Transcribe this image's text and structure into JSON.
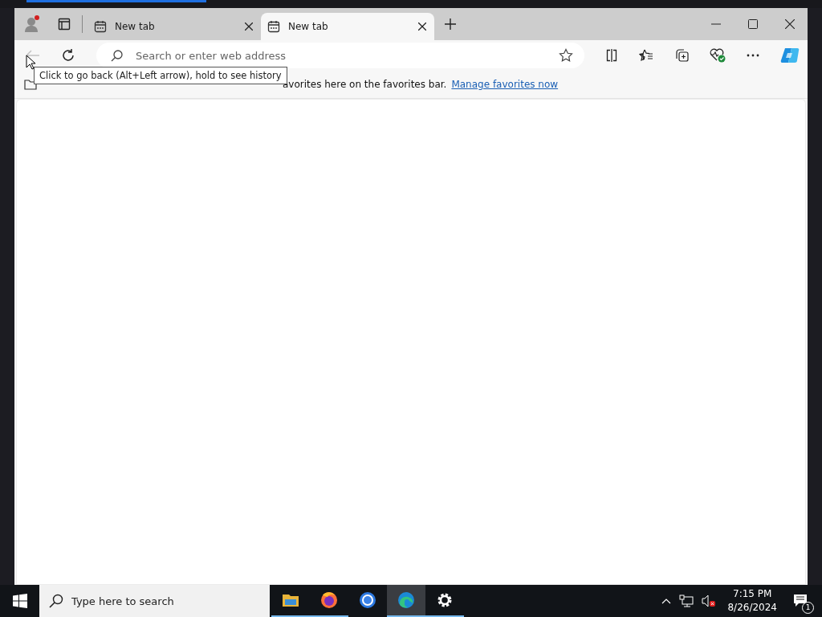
{
  "window": {
    "tabs": [
      {
        "label": "New tab",
        "selected": false
      },
      {
        "label": "New tab",
        "selected": true
      }
    ]
  },
  "toolbar": {
    "back_disabled": true,
    "address": {
      "placeholder": "Search or enter web address"
    }
  },
  "tooltip": {
    "text": "Click to go back (Alt+Left arrow), hold to see history"
  },
  "favorites_bar": {
    "message": "avorites here on the favorites bar.",
    "link": "Manage favorites now"
  },
  "taskbar": {
    "search": {
      "placeholder": "Type here to search"
    },
    "apps": [
      {
        "kind": "folder",
        "running": true,
        "selected": false
      },
      {
        "kind": "firefox",
        "running": true,
        "selected": false
      },
      {
        "kind": "chrome",
        "running": false,
        "selected": false
      },
      {
        "kind": "edge",
        "running": true,
        "selected": true
      },
      {
        "kind": "gear",
        "running": true,
        "selected": false
      }
    ],
    "time": "7:15 PM",
    "date": "8/26/2024",
    "notifications": "1"
  }
}
